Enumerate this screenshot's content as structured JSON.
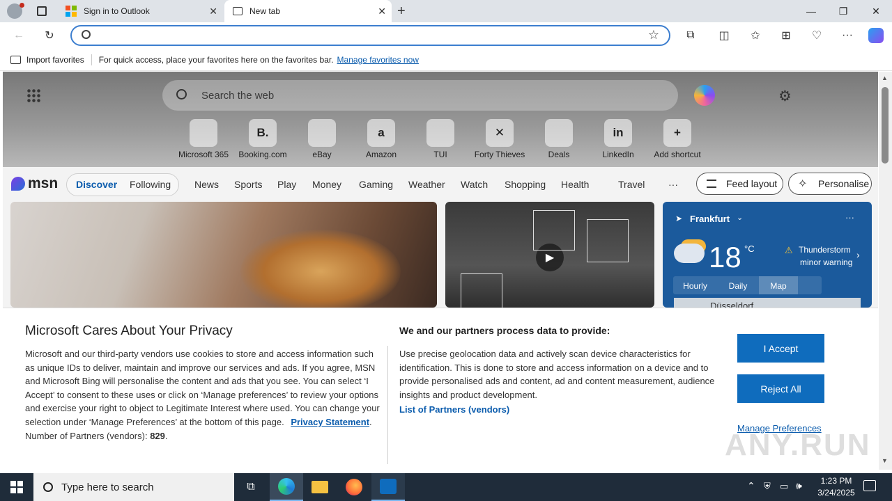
{
  "browser": {
    "tabs": [
      {
        "label": "Sign in to Outlook"
      },
      {
        "label": "New tab"
      }
    ],
    "address": {
      "value": "",
      "placeholder": ""
    },
    "favorites_bar": {
      "import_label": "Import favorites",
      "message": "For quick access, place your favorites here on the favorites bar.",
      "manage_link": "Manage favorites now"
    }
  },
  "newtab": {
    "search_placeholder": "Search the web",
    "shortcuts": [
      {
        "label": "Microsoft 365",
        "icon": "m365-icon"
      },
      {
        "label": "Booking.com",
        "icon": "booking-icon",
        "glyph": "B."
      },
      {
        "label": "eBay",
        "icon": "ebay-icon"
      },
      {
        "label": "Amazon",
        "icon": "amazon-icon",
        "glyph": "a"
      },
      {
        "label": "TUI",
        "icon": "tui-icon"
      },
      {
        "label": "Forty Thieves",
        "icon": "forty-thieves-icon",
        "glyph": "✕"
      },
      {
        "label": "Deals",
        "icon": "deals-icon"
      },
      {
        "label": "LinkedIn",
        "icon": "linkedin-icon",
        "glyph": "in"
      },
      {
        "label": "Add shortcut",
        "icon": "plus-icon",
        "glyph": "+"
      }
    ]
  },
  "msn": {
    "logo": "msn",
    "primary_tabs": [
      "Discover",
      "Following"
    ],
    "nav": [
      "News",
      "Sports",
      "Play",
      "Money",
      "Gaming",
      "Weather",
      "Watch",
      "Shopping",
      "Health",
      "Travel"
    ],
    "more": "···",
    "feed_layout": "Feed layout",
    "personalise": "Personalise"
  },
  "weather": {
    "location": "Frankfurt",
    "temp": "18",
    "unit": "°C",
    "alert_line1": "Thunderstorm",
    "alert_line2": "minor warning",
    "tabs": [
      "Hourly",
      "Daily",
      "Map"
    ],
    "map_label": "Düsseldorf"
  },
  "privacy": {
    "title": "Microsoft Cares About Your Privacy",
    "body": "Microsoft and our third-party vendors use cookies to store and access information such as unique IDs to deliver, maintain and improve our services and ads. If you agree, MSN and Microsoft Bing will personalise the content and ads that you see. You can select ‘I Accept’ to consent to these uses or click on ‘Manage preferences’ to review your options and exercise your right to object to Legitimate Interest where used.  You can change your selection under ‘Manage Preferences’ at the bottom of this page.",
    "privacy_link": "Privacy Statement",
    "partners_label": "Number of Partners (vendors):",
    "partners_count": "829",
    "right_title": "We and our partners process data to provide:",
    "right_body": "Use precise geolocation data and actively scan device characteristics for identification. This is done to store and access information on a device and to provide personalised ads and content, ad and content measurement, audience insights and product development.",
    "partners_link": "List of Partners (vendors)",
    "accept": "I Accept",
    "reject": "Reject All",
    "manage": "Manage Preferences"
  },
  "watermark": "ANY.RUN",
  "taskbar": {
    "search_placeholder": "Type here to search",
    "time": "1:23 PM",
    "date": "3/24/2025"
  },
  "colors": {
    "accent": "#0f6cbd",
    "link": "#0b5cad",
    "weather_bg": "#1b5a9c",
    "taskbar": "#1f2c3a"
  }
}
